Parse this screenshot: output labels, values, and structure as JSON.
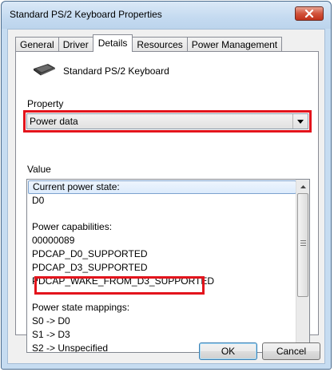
{
  "window": {
    "title": "Standard PS/2 Keyboard Properties"
  },
  "tabs": [
    {
      "label": "General",
      "active": false
    },
    {
      "label": "Driver",
      "active": false
    },
    {
      "label": "Details",
      "active": true
    },
    {
      "label": "Resources",
      "active": false
    },
    {
      "label": "Power Management",
      "active": false
    }
  ],
  "device": {
    "name": "Standard PS/2 Keyboard",
    "icon": "keyboard-icon"
  },
  "property": {
    "label": "Property",
    "selected": "Power data"
  },
  "value": {
    "label": "Value",
    "items": [
      "Current power state:",
      "D0",
      "",
      "Power capabilities:",
      "00000089",
      "PDCAP_D0_SUPPORTED",
      "PDCAP_D3_SUPPORTED",
      "PDCAP_WAKE_FROM_D3_SUPPORTED",
      "",
      "Power state mappings:",
      "S0 -> D0",
      "S1 -> D3",
      "S2 -> Unspecified"
    ]
  },
  "buttons": {
    "ok": "OK",
    "cancel": "Cancel"
  },
  "colors": {
    "highlight": "#e3141c",
    "selection": "#dcebfc"
  }
}
